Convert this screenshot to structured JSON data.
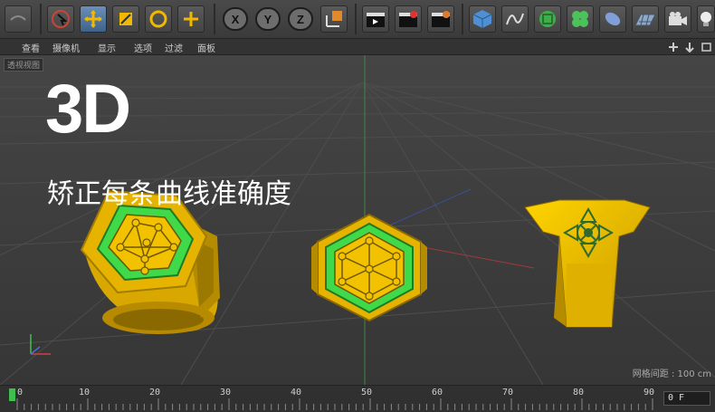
{
  "toolbar": {
    "axis_x": "X",
    "axis_y": "Y",
    "axis_z": "Z"
  },
  "menubar": {
    "items": [
      "查看",
      "摄像机",
      "显示",
      "选项",
      "过滤",
      "面板"
    ]
  },
  "viewport": {
    "view_label": "透视视图",
    "title_big": "3D",
    "title_sub": "矫正每条曲线准确度",
    "grid_info": "网格间距 : 100 cm"
  },
  "timeline": {
    "ticks": [
      "0",
      "10",
      "20",
      "30",
      "40",
      "50",
      "60",
      "70",
      "80",
      "90"
    ],
    "current_frame": "0 F"
  },
  "colors": {
    "gold": "#f2c200",
    "green": "#3fd94a",
    "accent_blue": "#4f7fb6"
  }
}
